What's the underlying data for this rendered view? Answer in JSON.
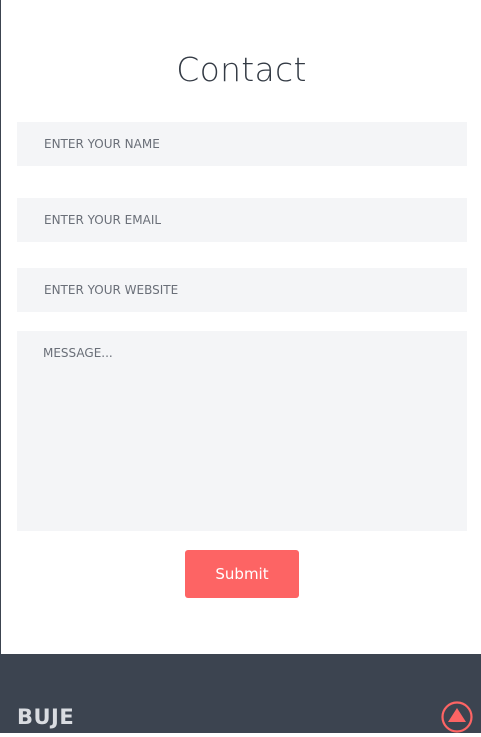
{
  "contact": {
    "title": "Contact",
    "name_placeholder": "ENTER YOUR NAME",
    "email_placeholder": "ENTER YOUR EMAIL",
    "website_placeholder": "ENTER YOUR WEBSITE",
    "message_placeholder": "MESSAGE...",
    "submit_label": "Submit"
  },
  "footer": {
    "brand": "BUJE",
    "scroll_top_icon": "arrow-up-circle-icon"
  },
  "colors": {
    "accent": "#fd6464",
    "footer_bg": "#3c4450",
    "field_bg": "#f4f5f7"
  }
}
